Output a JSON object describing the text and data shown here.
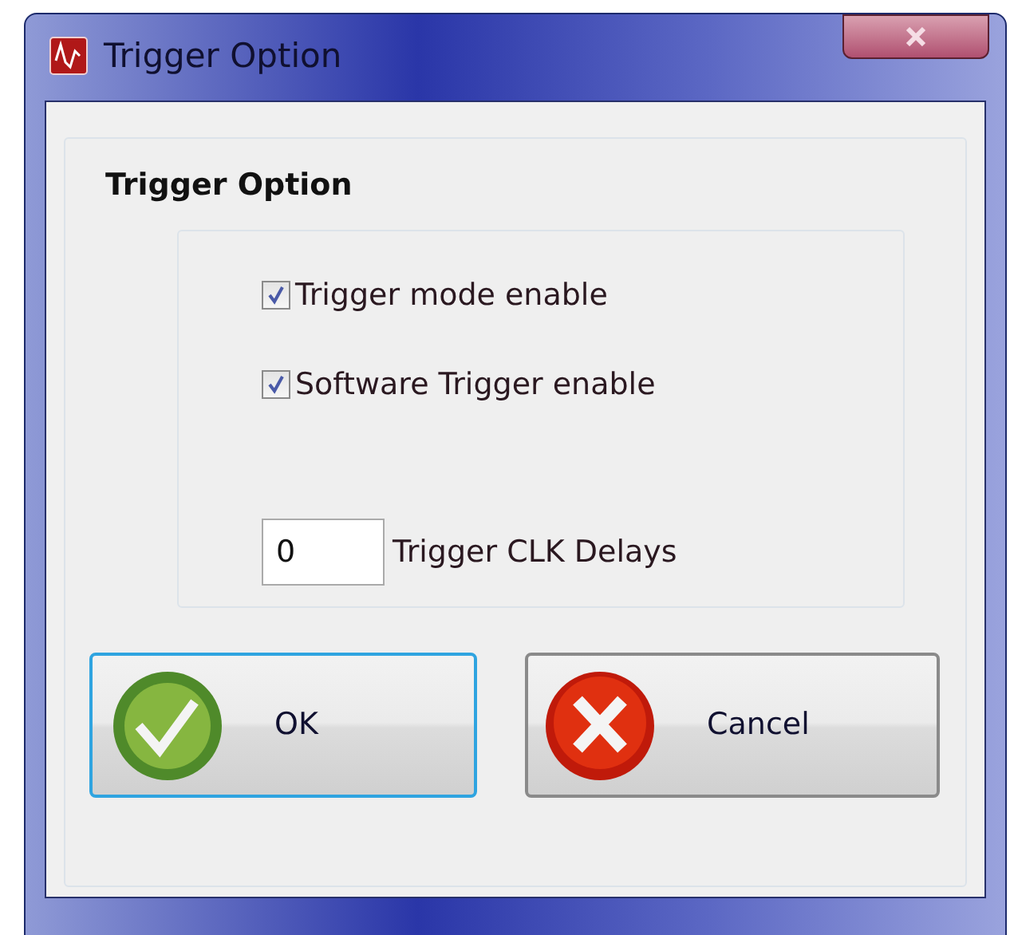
{
  "window": {
    "title": "Trigger Option"
  },
  "group": {
    "title": "Trigger Option"
  },
  "checkboxes": [
    {
      "label": "Trigger mode enable",
      "checked": true
    },
    {
      "label": "Software Trigger enable",
      "checked": true
    }
  ],
  "delay": {
    "value": "0",
    "label": "Trigger CLK Delays"
  },
  "buttons": [
    {
      "kind": "ok",
      "label": "OK",
      "focused": true
    },
    {
      "kind": "cancel",
      "label": "Cancel",
      "focused": false
    }
  ]
}
